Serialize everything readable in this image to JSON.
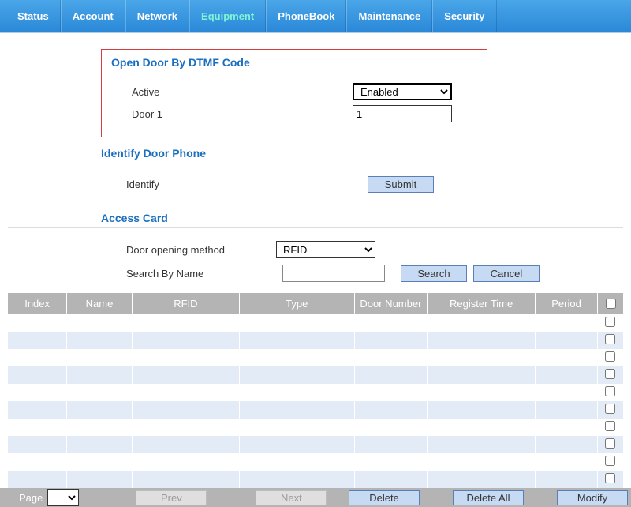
{
  "nav": {
    "tabs": [
      "Status",
      "Account",
      "Network",
      "Equipment",
      "PhoneBook",
      "Maintenance",
      "Security"
    ],
    "active_index": 3
  },
  "dtmf": {
    "title": "Open Door By DTMF Code",
    "active_label": "Active",
    "active_value": "Enabled",
    "door1_label": "Door 1",
    "door1_value": "1"
  },
  "identify": {
    "title": "Identify Door Phone",
    "row_label": "Identify",
    "submit": "Submit"
  },
  "access_card": {
    "title": "Access Card",
    "method_label": "Door opening method",
    "method_value": "RFID",
    "search_label": "Search By Name",
    "search_btn": "Search",
    "cancel_btn": "Cancel"
  },
  "table": {
    "headers": [
      "Index",
      "Name",
      "RFID",
      "Type",
      "Door Number",
      "Register Time",
      "Period"
    ],
    "rows": [
      {},
      {},
      {},
      {},
      {},
      {},
      {},
      {},
      {},
      {}
    ]
  },
  "footer": {
    "page_label": "Page",
    "prev": "Prev",
    "next": "Next",
    "delete": "Delete",
    "delete_all": "Delete All",
    "modify": "Modify"
  }
}
